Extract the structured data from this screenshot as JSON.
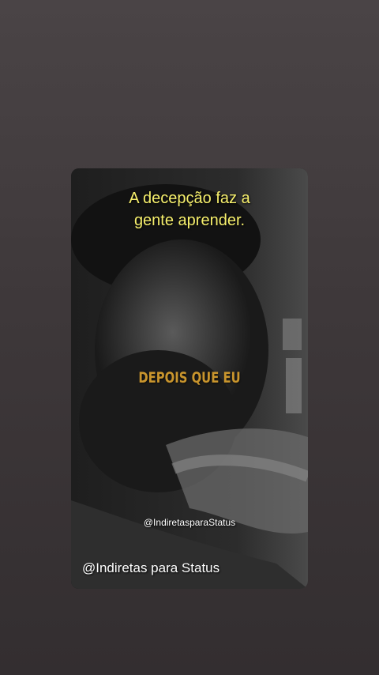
{
  "story": {
    "quote_line1": "A decepção faz a",
    "quote_line2": "gente aprender.",
    "overlay_text": "DEPOIS QUE EU",
    "watermark": "@IndiretasparaStatus",
    "account_handle": "@Indiretas para Status"
  },
  "colors": {
    "background": "#3e383a",
    "quote_text": "#f6ef6c",
    "overlay_text": "#c9952d",
    "handle_text": "#ffffff"
  }
}
